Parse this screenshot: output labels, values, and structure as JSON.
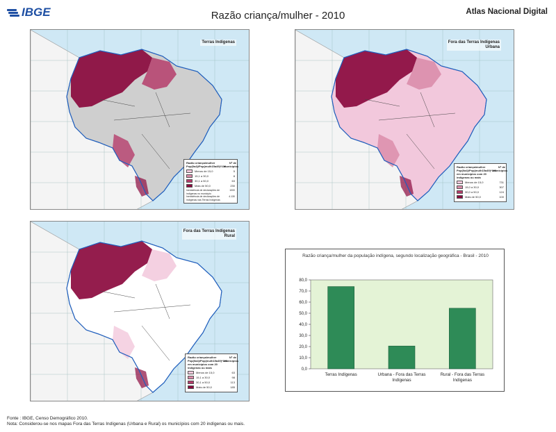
{
  "header": {
    "logo_text": "IBGE",
    "title": "Razão criança/mulher - 2010",
    "atlas": "Atlas Nacional Digital"
  },
  "colors": {
    "ocean": "#cfe8f5",
    "land": "#ececec",
    "dark": "#8b0a3e",
    "medium": "#b53d6b",
    "light": "#d98aa8",
    "lightest": "#f2c8dc",
    "hatched": "#cfcfcf",
    "bar": "#2e8b57",
    "plot_bg": "#e4f3d6"
  },
  "maps": [
    {
      "id": "map1",
      "title_lines": [
        "Terras Indígenas"
      ],
      "legend": {
        "header_left": "Razão criança/mulher Pop(0a4)/Pop(mulh15a49)*100",
        "header_right": "Nº de municípios",
        "rows": [
          {
            "label": "Menos de 15,0",
            "count": "5",
            "color": "#f2c8dc"
          },
          {
            "label": "15,1 a 30,0",
            "count": "8",
            "color": "#d98aa8"
          },
          {
            "label": "30,1 a 50,0",
            "count": "63",
            "color": "#b53d6b"
          },
          {
            "label": "Mais de 50,0",
            "count": "230",
            "color": "#8b0a3e"
          }
        ],
        "notes": [
          {
            "label": "Inexistência de declarações de indígenas no município",
            "count": "1000"
          },
          {
            "label": "Inexistência de declarações de indígenas nas Terras Indígenas",
            "count": "4.130"
          }
        ]
      }
    },
    {
      "id": "map2",
      "title_lines": [
        "Fora das Terras Indígenas",
        "Urbana"
      ],
      "legend": {
        "header_left": "Razão criança/mulher Pop(0a4)/Pop(mulh15a49)*100 em municípios com 20 indígenas ou mais",
        "header_right": "Nº de municípios",
        "rows": [
          {
            "label": "Menos de 15,0",
            "count": "731",
            "color": "#f2c8dc"
          },
          {
            "label": "15,0 a 30,0",
            "count": "307",
            "color": "#d98aa8"
          },
          {
            "label": "30,0 a 50,0",
            "count": "124",
            "color": "#b53d6b"
          },
          {
            "label": "Mais de 50,0",
            "count": "100",
            "color": "#8b0a3e"
          }
        ],
        "notes": []
      }
    },
    {
      "id": "map3",
      "title_lines": [
        "Fora das Terras Indígenas",
        "Rural"
      ],
      "legend": {
        "header_left": "Razão criança/mulher Pop(0a4)/Pop(mulh15a49)*100 em municípios com 20 indígenas ou mais",
        "header_right": "Nº de municípios",
        "rows": [
          {
            "label": "Menos de 15,0",
            "count": "63",
            "color": "#f2c8dc"
          },
          {
            "label": "15,1 a 30,0",
            "count": "98",
            "color": "#d98aa8"
          },
          {
            "label": "30,1 a 50,0",
            "count": "113",
            "color": "#b53d6b"
          },
          {
            "label": "Mais de 50,0",
            "count": "185",
            "color": "#8b0a3e"
          }
        ],
        "notes": []
      }
    }
  ],
  "chart_data": {
    "type": "bar",
    "title": "Razão criança/mulher da população indígena, segundo localização geográfica - Brasil - 2010",
    "categories": [
      [
        "Terras Indígenas"
      ],
      [
        "Urbana - Fora das Terras",
        "Indígenas"
      ],
      [
        "Rural - Fora das Terras",
        "Indígenas"
      ]
    ],
    "values": [
      74,
      20.5,
      54.5
    ],
    "ylim": [
      0,
      80
    ],
    "yticks": [
      "0,0",
      "10,0",
      "20,0",
      "30,0",
      "40,0",
      "50,0",
      "60,0",
      "70,0",
      "80,0"
    ],
    "xlabel": "",
    "ylabel": "",
    "grid": false
  },
  "footer": {
    "source": "Fonte : IBGE, Censo Demográfico 2010.",
    "note": "Nota: Considerou-se nos mapas Fora das Terras Indígenas (Urbana e Rural) os municípios com 20 indígenas ou mais."
  }
}
